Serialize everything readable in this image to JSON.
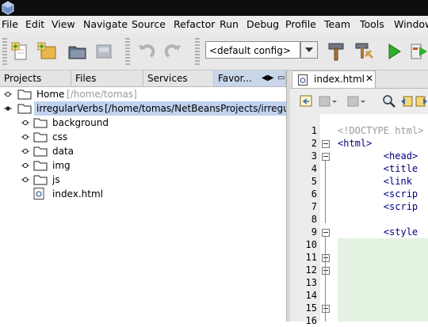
{
  "menu": [
    "File",
    "Edit",
    "View",
    "Navigate",
    "Source",
    "Refactor",
    "Run",
    "Debug",
    "Profile",
    "Team",
    "Tools",
    "Window"
  ],
  "toolbar": {
    "config": "<default config>"
  },
  "left_tabs": [
    "Projects",
    "Files",
    "Services",
    "Favor..."
  ],
  "tree": {
    "home_label": "Home",
    "home_path": "[/home/tomas]",
    "project_label": "irregularVerbs",
    "project_path": "[/home/tomas/NetBeansProjects/irregula",
    "children": [
      "background",
      "css",
      "data",
      "img",
      "js"
    ],
    "file": "index.html"
  },
  "editor": {
    "tab_label": "index.html",
    "line_numbers": [
      "1",
      "2",
      "3",
      "4",
      "5",
      "6",
      "7",
      "8",
      "9",
      "10",
      "11",
      "12",
      "13",
      "14",
      "15",
      "16"
    ],
    "lines": [
      "<!DOCTYPE html>",
      "<html>",
      "        <head>",
      "        <title",
      "        <link",
      "        <scrip",
      "        <scrip",
      "",
      "        <style",
      "",
      "",
      "",
      "",
      "",
      "",
      ""
    ]
  },
  "colors": {
    "selection": "#c1d2ee",
    "code_keyword": "#000080",
    "highlight": "#e4f2e2"
  }
}
